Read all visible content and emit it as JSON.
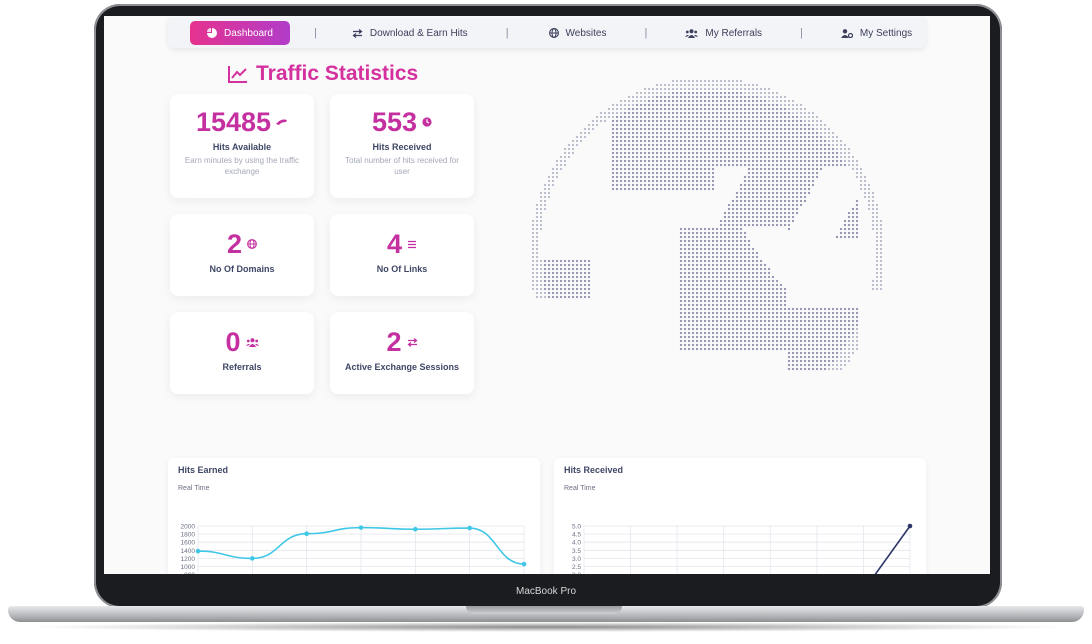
{
  "nav": {
    "items": [
      {
        "label": "Dashboard",
        "icon": "pie-chart-icon"
      },
      {
        "label": "Download & Earn Hits",
        "icon": "exchange-arrows-icon"
      },
      {
        "label": "Websites",
        "icon": "globe-icon"
      },
      {
        "label": "My Referrals",
        "icon": "users-icon"
      },
      {
        "label": "My Settings",
        "icon": "user-gear-icon"
      }
    ],
    "separator": "|"
  },
  "page_title": "Traffic Statistics",
  "stats": {
    "hits_available": {
      "value": "15485",
      "label": "Hits Available",
      "desc": "Earn minutes by using the traffic exchange"
    },
    "hits_received": {
      "value": "553",
      "label": "Hits Received",
      "desc": "Total number of hits received for user"
    },
    "domains": {
      "value": "2",
      "label": "No Of Domains"
    },
    "links": {
      "value": "4",
      "label": "No Of Links"
    },
    "referrals": {
      "value": "0",
      "label": "Referrals"
    },
    "sessions": {
      "value": "2",
      "label": "Active Exchange Sessions"
    }
  },
  "device_label": "MacBook Pro",
  "colors": {
    "accent": "#c4309f",
    "line1": "#3fc7e6",
    "line2": "#2c3566"
  },
  "chart_data": [
    {
      "type": "line",
      "title": "Hits Earned",
      "subtitle": "Real Time",
      "y_ticks": [
        "2000",
        "1800",
        "1600",
        "1400",
        "1200",
        "1000",
        "800"
      ],
      "ylim": [
        800,
        2000
      ],
      "values": [
        1380,
        1200,
        1810,
        1960,
        1920,
        1950,
        1060
      ]
    },
    {
      "type": "line",
      "title": "Hits Received",
      "subtitle": "Real Time",
      "y_ticks": [
        "5.0",
        "4.5",
        "4.0",
        "3.5",
        "3.0",
        "2.5",
        "2.0"
      ],
      "ylim": [
        2.0,
        5.0
      ],
      "values": [
        null,
        null,
        null,
        null,
        null,
        null,
        1.0,
        5.0
      ]
    }
  ]
}
